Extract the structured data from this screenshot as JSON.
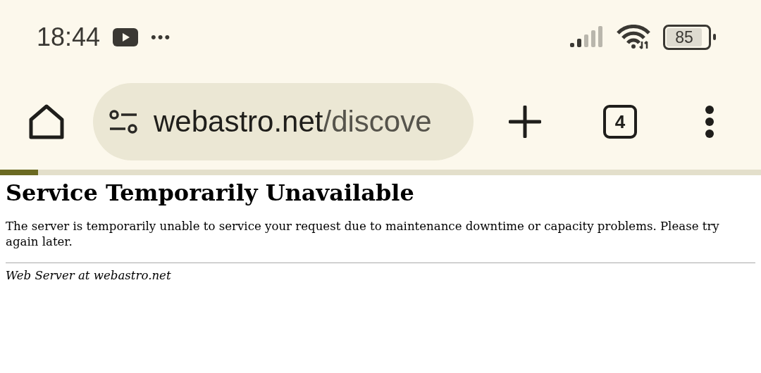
{
  "status_bar": {
    "time": "18:44",
    "notification_more": "•••",
    "battery": "85"
  },
  "toolbar": {
    "url_host": "webastro.net",
    "url_path": "/discove",
    "tab_count": "4"
  },
  "load_progress": {
    "level": 0.05
  },
  "page": {
    "heading": "Service Temporarily Unavailable",
    "message": "The server is temporarily unable to service your request due to maintenance downtime or capacity problems. Please try again later.",
    "footer": "Web Server at webastro.net"
  }
}
